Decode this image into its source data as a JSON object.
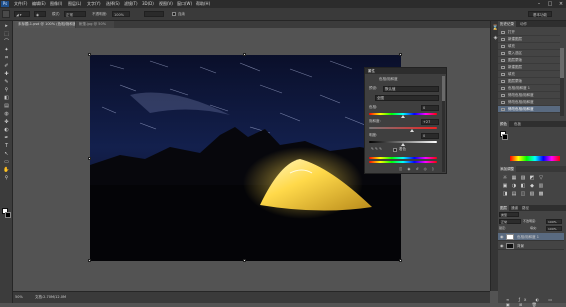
{
  "app": {
    "name": "Ps"
  },
  "menu": [
    "文件(F)",
    "编辑(E)",
    "图像(I)",
    "图层(L)",
    "文字(Y)",
    "选择(S)",
    "滤镜(T)",
    "3D(D)",
    "视图(V)",
    "窗口(W)",
    "帮助(H)"
  ],
  "window_controls": [
    "–",
    "□",
    "×"
  ],
  "options_bar": {
    "mode_label": "模式:",
    "mode_value": "正常",
    "opacity_label": "不透明度:",
    "opacity_value": "100%",
    "checkbox_label": "连续",
    "essentials": "基本功能"
  },
  "tabs": [
    {
      "label": "未标题-1.psd @ 100% (色相/饱和度 1, 图层蒙版/8) *",
      "active": true
    },
    {
      "label": "帐篷.jpg @ 50%",
      "active": false
    }
  ],
  "tools": [
    "▸",
    "⬚",
    "⌒",
    "✦",
    "⌗",
    "✐",
    "✚",
    "✎",
    "⚲",
    "◧",
    "▤",
    "◍",
    "✤",
    "◐",
    "✒",
    "T",
    "↖",
    "▭",
    "✋",
    "⚲"
  ],
  "properties": {
    "title": "属性",
    "subtitle": "色相/饱和度",
    "preset_label": "预设:",
    "preset_value": "默认值",
    "channel_value": "全图",
    "hue_label": "色相:",
    "hue_value": "0",
    "saturation_label": "饱和度:",
    "saturation_value": "+27",
    "lightness_label": "明度:",
    "lightness_value": "0",
    "colorize_label": "着色",
    "hue_level": 0.5,
    "saturation_level": 0.63,
    "lightness_level": 0.5
  },
  "history": {
    "tabs": [
      "历史记录",
      "动作"
    ],
    "items": [
      "打开",
      "新建图层",
      "填充",
      "载入选区",
      "图层蒙版",
      "新建图层",
      "填充",
      "图层蒙版",
      "色相/饱和度 1",
      "修改色相/饱和度",
      "修改色相/饱和度",
      "修改色相/饱和度"
    ],
    "selected_index": 11
  },
  "adjustments": {
    "tabs": [
      "颜色",
      "色板"
    ],
    "add_label": "添加调整",
    "icons_row1": [
      "☼",
      "▦",
      "▨",
      "◩",
      "▽"
    ],
    "icons_row2": [
      "▣",
      "◑",
      "◧",
      "◆",
      "▥"
    ],
    "icons_row3": [
      "◨",
      "▤",
      "◫",
      "▧",
      "▩"
    ]
  },
  "layers": {
    "tabs": [
      "图层",
      "通道",
      "路径"
    ],
    "kind_label": "类型",
    "blend_mode": "正常",
    "opacity_label": "不透明度:",
    "opacity_value": "100%",
    "lock_label": "锁定:",
    "fill_label": "填充:",
    "fill_value": "100%",
    "rows": [
      {
        "name": "色相/饱和度 1",
        "selected": true
      },
      {
        "name": "背景",
        "selected": false
      }
    ]
  },
  "status": {
    "zoom": "50%",
    "doc": "文档:2.70M/12.0M"
  },
  "colors": {
    "ui_bg": "#535353",
    "panel_bg": "#444444",
    "selection": "#596a80",
    "tent": "#ffd94a",
    "sky": "#0f1430"
  }
}
